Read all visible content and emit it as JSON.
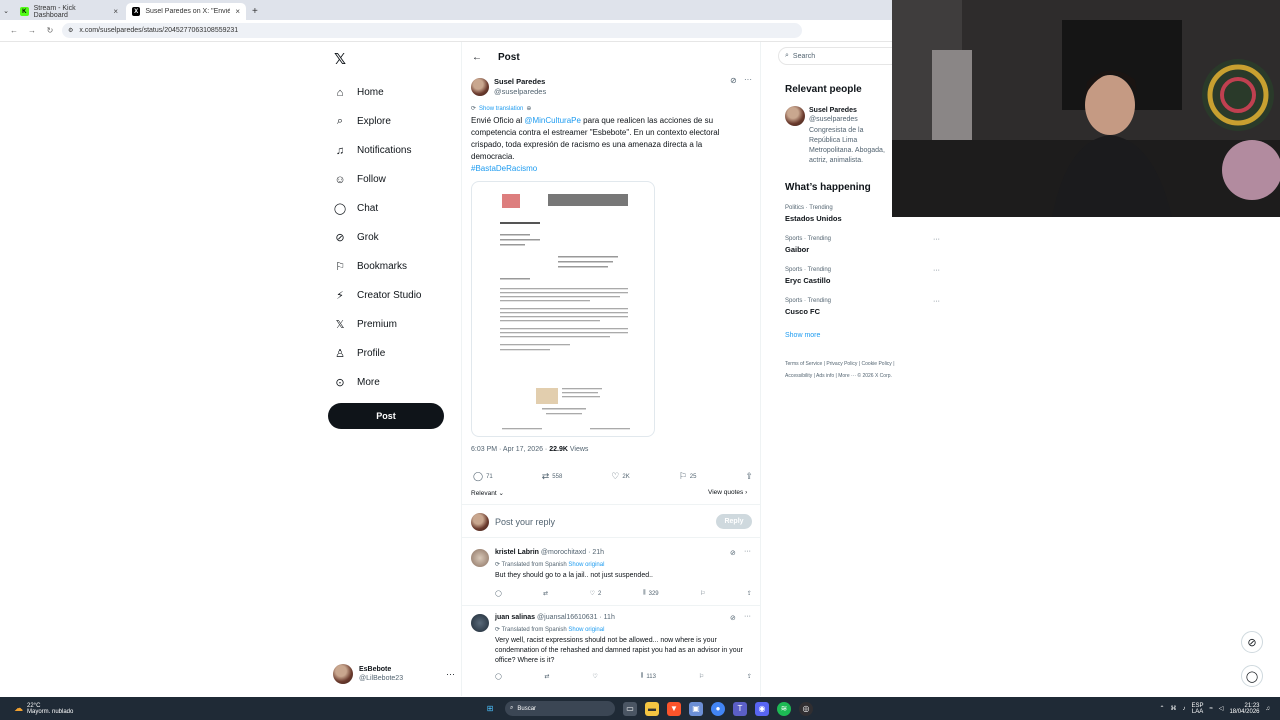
{
  "browser": {
    "tabs": [
      {
        "label": "Stream - Kick Dashboard",
        "active": false
      },
      {
        "label": "Susel Paredes on X: \"Envié Ofici",
        "active": true
      }
    ],
    "url": "x.com/suselparedes/status/2045277063108559231"
  },
  "nav": {
    "items": [
      {
        "label": "Home",
        "icon": "home-icon"
      },
      {
        "label": "Explore",
        "icon": "search-icon"
      },
      {
        "label": "Notifications",
        "icon": "bell-icon"
      },
      {
        "label": "Follow",
        "icon": "follow-icon"
      },
      {
        "label": "Chat",
        "icon": "chat-icon"
      },
      {
        "label": "Grok",
        "icon": "grok-icon"
      },
      {
        "label": "Bookmarks",
        "icon": "bookmark-icon"
      },
      {
        "label": "Creator Studio",
        "icon": "creator-icon"
      },
      {
        "label": "Premium",
        "icon": "x-icon"
      },
      {
        "label": "Profile",
        "icon": "user-icon"
      },
      {
        "label": "More",
        "icon": "more-icon"
      }
    ],
    "post_label": "Post",
    "account": {
      "name": "EsBebote",
      "handle": "@LilBebote23"
    }
  },
  "post": {
    "header": "Post",
    "author": "Susel Paredes",
    "handle": "@suselparedes",
    "show_translation": "Show translation",
    "text_before_mention": "Envié Oficio al ",
    "mention": "@MinCulturaPe",
    "text_after_mention": " para que  realicen las acciones de su competencia contra el estreamer \"Esbebote\". En un contexto electoral crispado, toda expresión de racismo es una amenaza directa a la democracia.",
    "hashtag": "#BastaDeRacismo",
    "time": "6:03 PM · Apr 17, 2026 · ",
    "views_count": "22.9K",
    "views_label": " Views",
    "replies": "71",
    "reposts": "558",
    "likes": "2K",
    "bookmarks": "25",
    "sort": "Relevant",
    "view_quotes": "View quotes",
    "reply_placeholder": "Post your reply",
    "reply_button": "Reply"
  },
  "replies": [
    {
      "name": "kristel Labrin",
      "handle": "@morochitaxd · 21h",
      "translated": "Translated from Spanish",
      "show_original": "Show original",
      "text": "But they should go to a la jail.. not just suspended..",
      "reposts": "",
      "likes": "2",
      "views": "329"
    },
    {
      "name": "juan salinas",
      "handle": "@juansal16610631 · 11h",
      "translated": "Translated from Spanish",
      "show_original": "Show original",
      "text": "Very well, racist expressions should not be allowed... now where is your condemnation of the rehashed and damned rapist you had as an advisor in your office? Where is it?",
      "reposts": "",
      "likes": "",
      "views": "113"
    }
  ],
  "right": {
    "search_placeholder": "Search",
    "relevant_title": "Relevant people",
    "person": {
      "name": "Susel Paredes",
      "handle": "@suselparedes",
      "bio": "Congresista de la República Lima Metropolitana. Abogada, actriz, animalista."
    },
    "happening_title": "What’s happening",
    "trends": [
      {
        "meta": "Politics · Trending",
        "name": "Estados Unidos"
      },
      {
        "meta": "Sports · Trending",
        "name": "Gaibor"
      },
      {
        "meta": "Sports · Trending",
        "name": "Eryc Castillo"
      },
      {
        "meta": "Sports · Trending",
        "name": "Cusco FC"
      }
    ],
    "show_more": "Show more",
    "footer": [
      "Terms of Service",
      "Privacy Policy",
      "Cookie Policy",
      "Accessibility",
      "Ads info",
      "More ···",
      "© 2026 X Corp."
    ]
  },
  "taskbar": {
    "weather_temp": "22°C",
    "weather_desc": "Mayorm. nublado",
    "search_placeholder": "Buscar",
    "lang": "ESP",
    "lang_sub": "LAA",
    "time": "21:23",
    "date": "18/04/2026"
  }
}
